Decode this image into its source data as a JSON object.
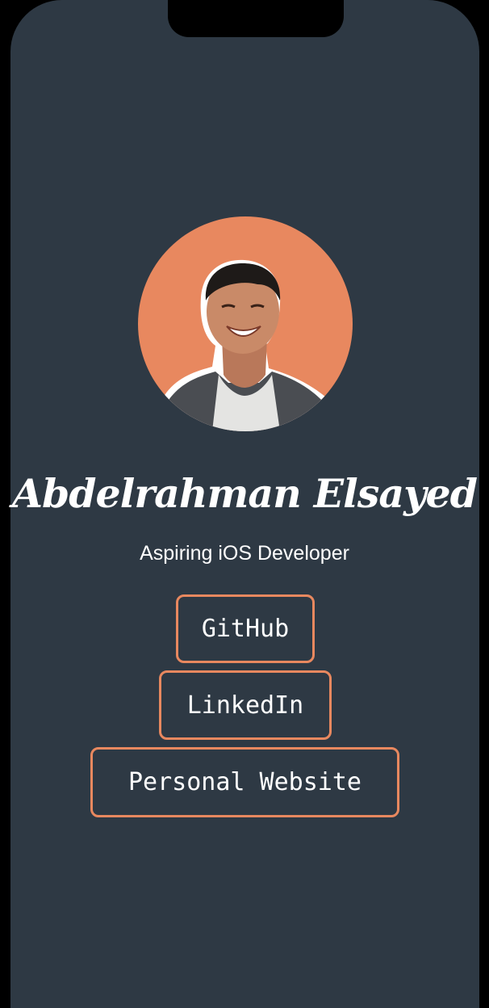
{
  "profile": {
    "name": "Abdelrahman Elsayed",
    "subtitle": "Aspiring iOS Developer",
    "avatar_alt": "profile-photo"
  },
  "links": {
    "github": "GitHub",
    "linkedin": "LinkedIn",
    "website": "Personal Website"
  },
  "colors": {
    "background": "#2e3944",
    "accent": "#e8885f",
    "text": "#ffffff"
  }
}
